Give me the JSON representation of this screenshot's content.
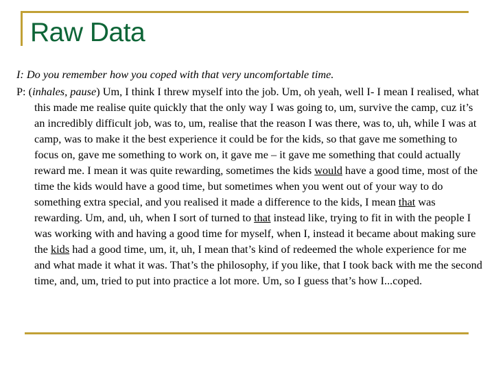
{
  "slide": {
    "title": "Raw Data",
    "accent_color": "#c1a035",
    "title_color": "#0e6537"
  },
  "transcript": {
    "interviewer": {
      "speaker": "I:",
      "text": "Do you remember how you coped with that very uncomfortable time."
    },
    "participant": {
      "speaker": "P:",
      "open_paren": "(",
      "stage_direction": "inhales, pause",
      "close_paren": ")",
      "seg1": " Um, I think I threw myself into the job. Um, oh yeah, well I- I mean I realised, what this made me realise quite quickly that the only way I was going to, um, survive the camp, cuz it’s an incredibly difficult job, was to, um, realise that the reason I was there, was to, uh, while I was at camp, was to make it the best experience it could be for the kids, so that gave me something to focus on, gave me something to work on, it gave me – it gave me something that could actually reward me. I mean it was quite rewarding, sometimes the kids ",
      "u1": "would",
      "seg2": " have a good time, most of the time the kids would have a good time, but sometimes when you went out of your way to do something extra special, and you realised it made a difference to the kids, I mean ",
      "u2": "that",
      "seg3": " was rewarding.  Um, and, uh, when I sort of turned to ",
      "u3": "that",
      "seg4": " instead like, trying to fit in with the people I was working with and having a good time for myself, when I, instead it became about making sure the ",
      "u4": "kids",
      "seg5": " had a good time, um, it, uh, I mean that’s kind of redeemed the whole experience for me and what made it what it was. That’s the philosophy, if you like, that I took back with me the second time, and, um, tried to put into practice a lot more. Um, so I guess that’s how I...coped."
    }
  }
}
